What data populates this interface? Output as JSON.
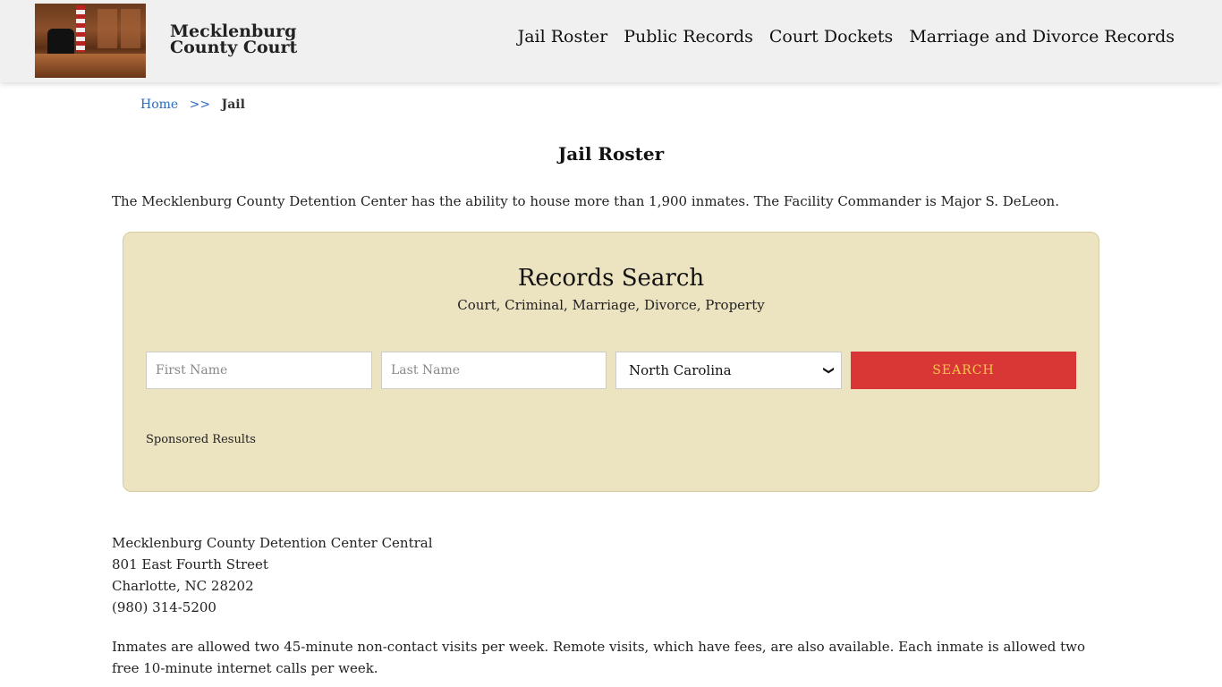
{
  "header": {
    "site_title": "Mecklenburg County Court",
    "logo_alt": "courtroom-image",
    "nav": [
      "Jail Roster",
      "Public Records",
      "Court Dockets",
      "Marriage and Divorce Records"
    ]
  },
  "breadcrumb": {
    "home": "Home",
    "separator": ">>",
    "current": "Jail"
  },
  "main": {
    "title": "Jail Roster",
    "intro": "The Mecklenburg County Detention Center has the ability to house more than 1,900 inmates. The Facility Commander is Major S. DeLeon."
  },
  "search": {
    "title": "Records Search",
    "subtitle": "Court, Criminal, Marriage, Divorce, Property",
    "first_name_placeholder": "First Name",
    "last_name_placeholder": "Last Name",
    "state_selected": "North Carolina",
    "button_label": "SEARCH",
    "sponsored": "Sponsored Results",
    "colors": {
      "box": "#ece3c0",
      "button": "#d93636",
      "button_text": "#f6c84a"
    }
  },
  "address": {
    "name": "Mecklenburg County Detention Center Central",
    "street": "801 East Fourth Street",
    "city": "Charlotte, NC 28202",
    "phone": "(980) 314-5200"
  },
  "visits_text": "Inmates are allowed two 45-minute non-contact visits per week. Remote visits, which have fees, are also available. Each inmate is allowed two free 10-minute internet calls per week."
}
